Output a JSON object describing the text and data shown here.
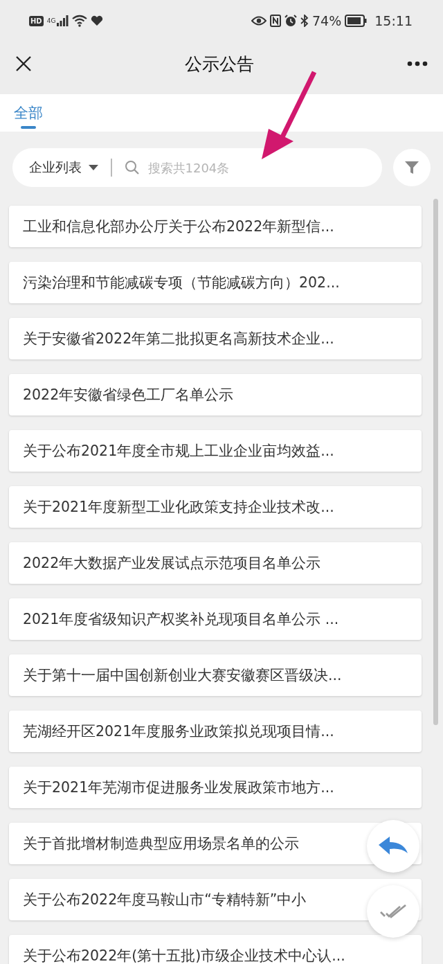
{
  "status_bar": {
    "network_badge": "HD",
    "network_type": "4G",
    "battery": "74%",
    "time": "15:11"
  },
  "header": {
    "title": "公示公告"
  },
  "tabs": [
    {
      "label": "全部",
      "selected": true
    }
  ],
  "search": {
    "dropdown": "企业列表",
    "placeholder": "搜索共1204条"
  },
  "items": [
    {
      "title": "工业和信息化部办公厅关于公布2022年新型信..."
    },
    {
      "title": "污染治理和节能减碳专项（节能减碳方向）202..."
    },
    {
      "title": "关于安徽省2022年第二批拟更名高新技术企业..."
    },
    {
      "title": "2022年安徽省绿色工厂名单公示"
    },
    {
      "title": "关于公布2021年度全市规上工业企业亩均效益..."
    },
    {
      "title": "关于2021年度新型工业化政策支持企业技术改..."
    },
    {
      "title": "2022年大数据产业发展试点示范项目名单公示"
    },
    {
      "title": "2021年度省级知识产权奖补兑现项目名单公示 ..."
    },
    {
      "title": "关于第十一届中国创新创业大赛安徽赛区晋级决..."
    },
    {
      "title": "芜湖经开区2021年度服务业政策拟兑现项目情..."
    },
    {
      "title": "关于2021年芜湖市促进服务业发展政策市地方..."
    },
    {
      "title": "关于首批增材制造典型应用场景名单的公示"
    },
    {
      "title": "关于公布2022年度马鞍山市“专精特新”中小"
    },
    {
      "title": "关于公布2022年(第十五批)市级企业技术中心认..."
    }
  ]
}
